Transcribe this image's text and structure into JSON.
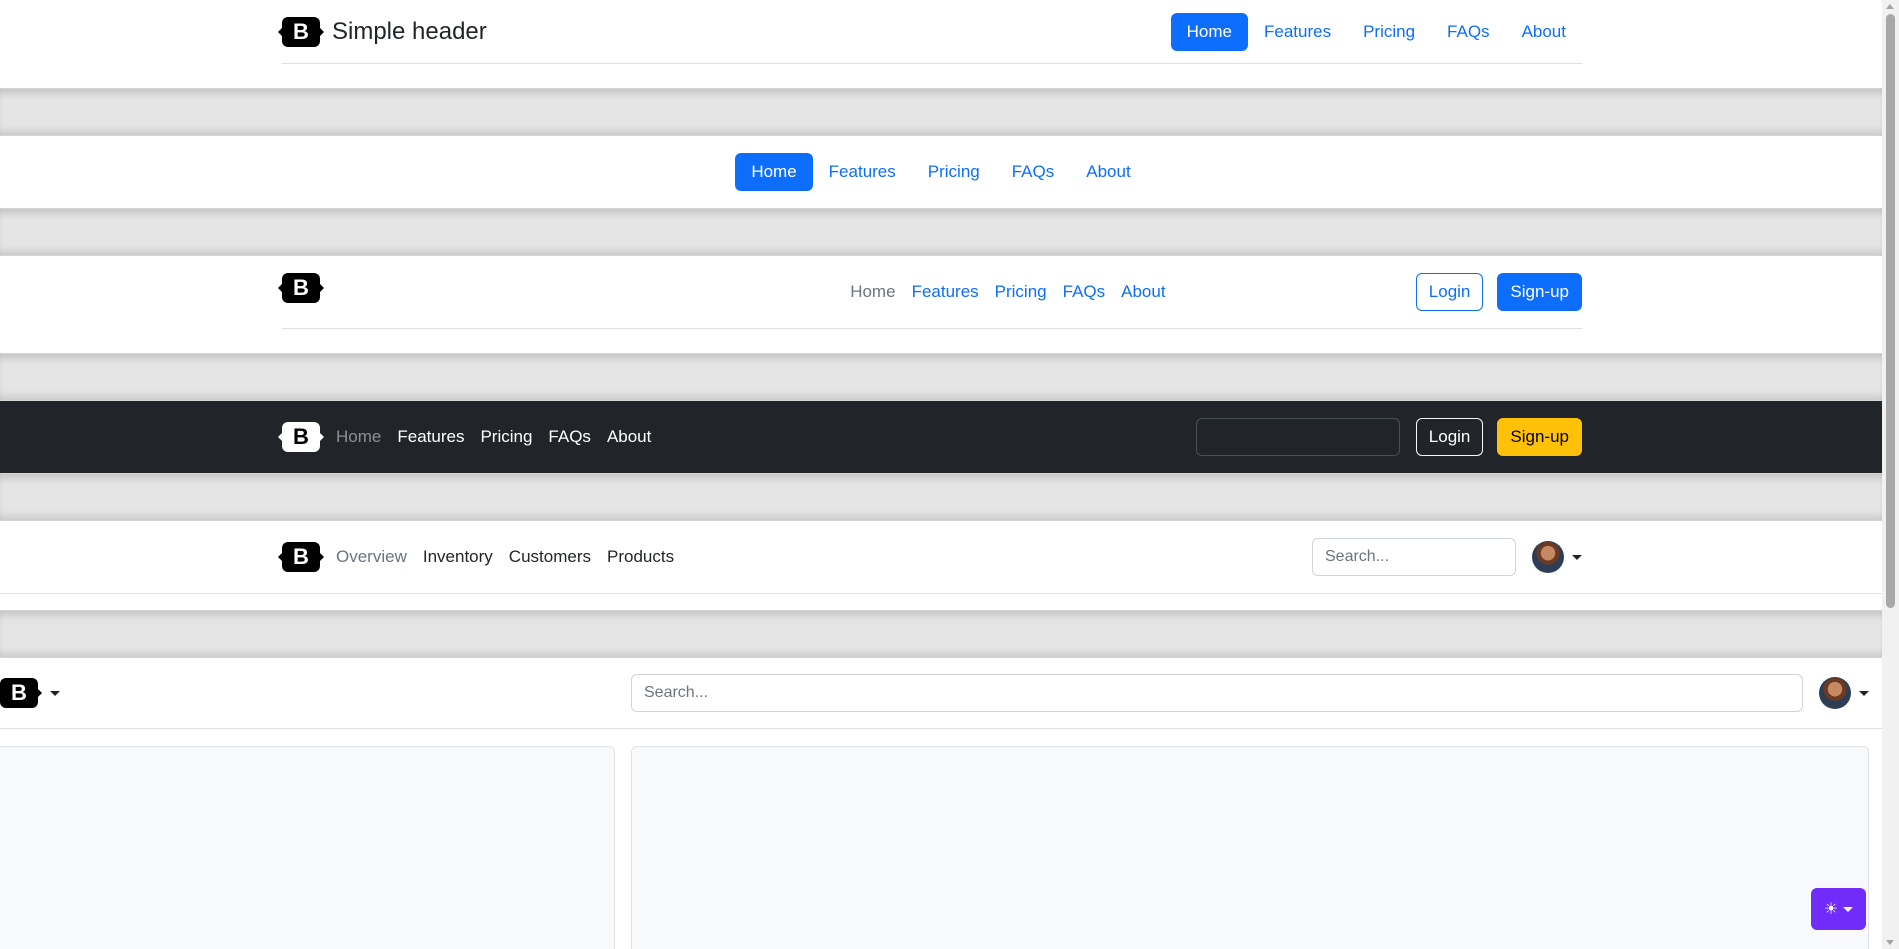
{
  "header1": {
    "brand_title": "Simple header",
    "logo_letter": "B",
    "nav": [
      "Home",
      "Features",
      "Pricing",
      "FAQs",
      "About"
    ],
    "active": "Home"
  },
  "header2": {
    "nav": [
      "Home",
      "Features",
      "Pricing",
      "FAQs",
      "About"
    ],
    "active": "Home"
  },
  "header3": {
    "logo_letter": "B",
    "nav": [
      "Home",
      "Features",
      "Pricing",
      "FAQs",
      "About"
    ],
    "login_label": "Login",
    "signup_label": "Sign-up"
  },
  "header4": {
    "logo_letter": "B",
    "nav": [
      "Home",
      "Features",
      "Pricing",
      "FAQs",
      "About"
    ],
    "search_value": "",
    "login_label": "Login",
    "signup_label": "Sign-up"
  },
  "header5": {
    "logo_letter": "B",
    "nav": [
      "Overview",
      "Inventory",
      "Customers",
      "Products"
    ],
    "search_placeholder": "Search..."
  },
  "header6": {
    "logo_letter": "B",
    "search_placeholder": "Search..."
  },
  "theme_toggle": {
    "icon": "sun-icon"
  },
  "colors": {
    "primary": "#0d6efd",
    "dark": "#212529",
    "warning": "#ffc107",
    "theme": "#712cf9"
  }
}
